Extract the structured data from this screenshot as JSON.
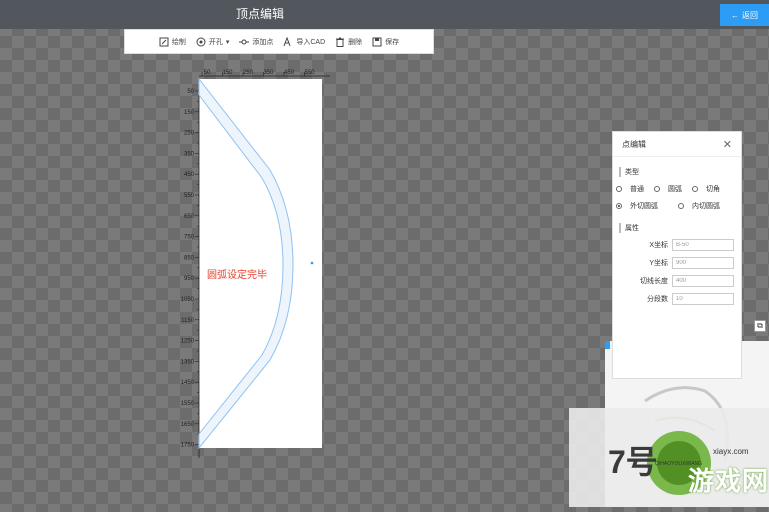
{
  "header": {
    "title": "顶点编辑",
    "back_label": "返回",
    "back_icon": "arrow-left-icon"
  },
  "toolbar": {
    "items": [
      {
        "label": "绘制",
        "icon": "draw-icon"
      },
      {
        "label": "开孔",
        "icon": "drill-icon"
      },
      {
        "label": "添加点",
        "icon": "add-point-icon"
      },
      {
        "label": "导入CAD",
        "icon": "import-cad-icon"
      },
      {
        "label": "删除",
        "icon": "trash-icon"
      },
      {
        "label": "保存",
        "icon": "save-icon"
      }
    ]
  },
  "ruler": {
    "x_ticks": [
      "50",
      "150",
      "250",
      "350",
      "450",
      "550"
    ],
    "y_ticks": [
      "50",
      "150",
      "250",
      "350",
      "450",
      "550",
      "650",
      "750",
      "850",
      "950",
      "1050",
      "1150",
      "1250",
      "1350",
      "1450",
      "1550",
      "1650",
      "1750"
    ]
  },
  "canvas": {
    "message": "圆弧设定完毕",
    "message_color": "#e8412e",
    "accent": "#2d9cf4"
  },
  "panel": {
    "title": "点编辑",
    "type_section": "类型",
    "types": [
      {
        "label": "普通",
        "selected": false
      },
      {
        "label": "圆弧",
        "selected": false
      },
      {
        "label": "切角",
        "selected": false
      },
      {
        "label": "外切圆弧",
        "selected": true
      },
      {
        "label": "内切圆弧",
        "selected": false
      }
    ],
    "props_section": "属性",
    "fields": [
      {
        "label": "X坐标",
        "value": "B-50"
      },
      {
        "label": "Y坐标",
        "value": "900"
      },
      {
        "label": "切线长度",
        "value": "400"
      },
      {
        "label": "分段数",
        "value": "10"
      }
    ]
  },
  "watermark": {
    "big": "7号",
    "text": "游戏网",
    "url": "xiayx.com",
    "sub": "QIHAOYOUXIWANG"
  }
}
